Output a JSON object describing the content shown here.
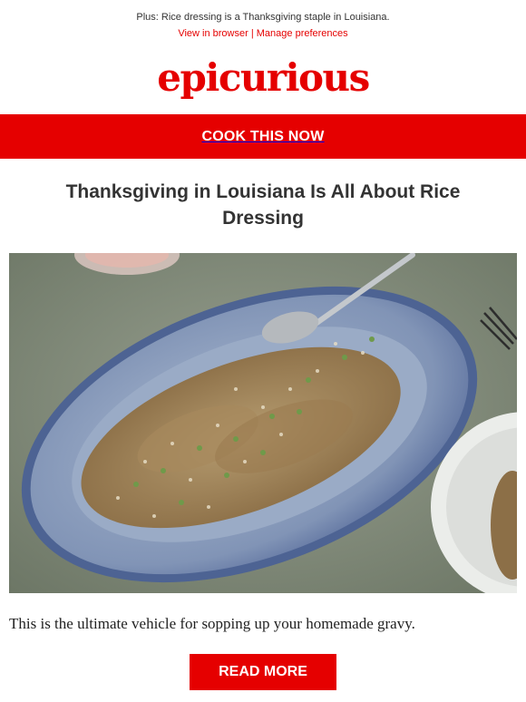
{
  "preheader": {
    "text": "Plus: Rice dressing is a Thanksgiving staple in Louisiana.",
    "view_in_browser": "View in browser",
    "separator": "|",
    "manage_preferences": "Manage preferences"
  },
  "brand": {
    "logo_text": "epicurious",
    "color": "#e50000"
  },
  "banner": {
    "label": "COOK THIS NOW"
  },
  "article": {
    "headline": "Thanksgiving in Louisiana Is All About Rice Dressing",
    "description": "This is the ultimate vehicle for sopping up your homemade gravy.",
    "cta_label": "READ MORE"
  },
  "hero_image": {
    "subject": "rice-dressing-platter"
  }
}
